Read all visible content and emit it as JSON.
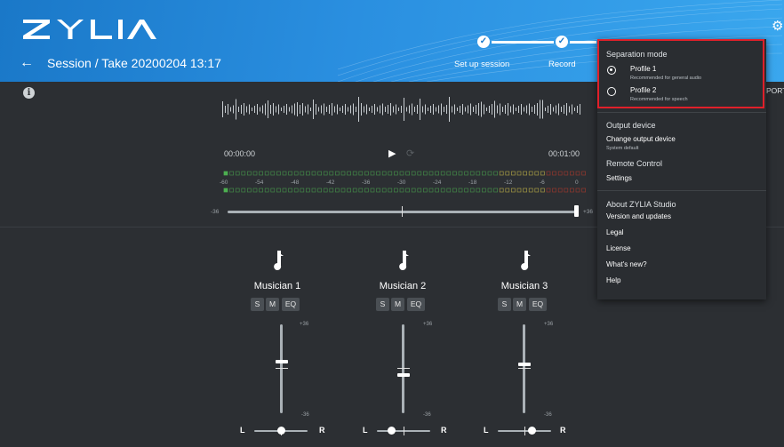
{
  "header": {
    "logo_text": "ZYLIA",
    "session_title": "Session / Take 20200204 13:17",
    "steps": [
      {
        "label": "Set up session",
        "done": true
      },
      {
        "label": "Record",
        "done": true
      }
    ]
  },
  "export_partial": "PORT",
  "transport": {
    "time_start": "00:00:00",
    "time_end": "00:01:00"
  },
  "meter": {
    "scale": [
      "-60",
      "-54",
      "-48",
      "-42",
      "-36",
      "-30",
      "-24",
      "-18",
      "-12",
      "-6",
      "0"
    ]
  },
  "master": {
    "min_label": "-36",
    "max_label": "+36",
    "level": 1.0
  },
  "channels": [
    {
      "name": "Musician 1",
      "s": "S",
      "m": "M",
      "eq": "EQ",
      "max": "+36",
      "min": "-36",
      "fader": 0.42,
      "pan": 0.5,
      "pan_l": "L",
      "pan_r": "R"
    },
    {
      "name": "Musician 2",
      "s": "S",
      "m": "M",
      "eq": "EQ",
      "max": "+36",
      "min": "-36",
      "fader": 0.5,
      "pan": 0.25,
      "pan_l": "L",
      "pan_r": "R"
    },
    {
      "name": "Musician 3",
      "s": "S",
      "m": "M",
      "eq": "EQ",
      "max": "+36",
      "min": "-36",
      "fader": 0.45,
      "pan": 0.65,
      "pan_l": "L",
      "pan_r": "R"
    }
  ],
  "menu": {
    "separation_title": "Separation mode",
    "profile1": {
      "label": "Profile 1",
      "desc": "Recommended for general audio",
      "selected": true
    },
    "profile2": {
      "label": "Profile 2",
      "desc": "Recommended for speech",
      "selected": false
    },
    "output_title": "Output device",
    "change_output": "Change output device",
    "output_value": "System default",
    "remote_control": "Remote Control",
    "settings": "Settings",
    "about_title": "About ZYLIA Studio",
    "version": "Version and updates",
    "legal": "Legal",
    "license": "License",
    "whats_new": "What's new?",
    "help": "Help"
  },
  "colors": {
    "header_blue": "#2a8fe0",
    "highlight_red": "#e0202a",
    "meter_green": "#4caf50",
    "meter_yellow": "#d8c84a",
    "meter_red": "#c0392b"
  }
}
